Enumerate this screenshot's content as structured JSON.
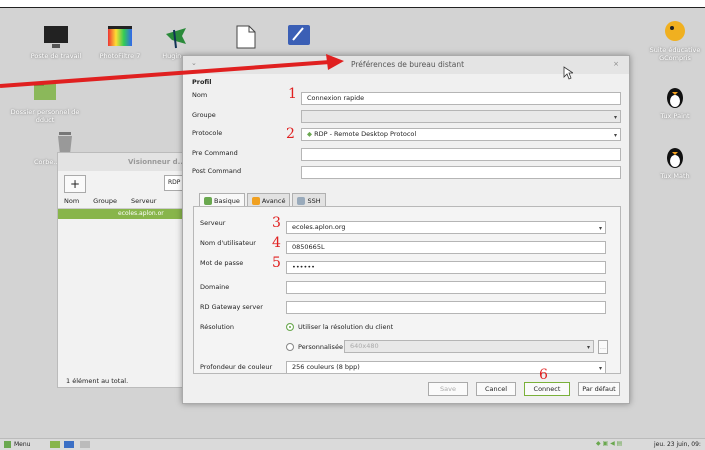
{
  "desktop": {
    "left_icons": [
      {
        "label": "Poste de travail"
      },
      {
        "label": "PhotoFiltre 7"
      },
      {
        "label": "Hugin-..."
      },
      {
        "label": "Dossier personnel de dduct"
      },
      {
        "label": "Corbe..."
      }
    ],
    "right_icons": [
      {
        "label": "Suite éducative GCompris"
      },
      {
        "label": "Tux Paint"
      },
      {
        "label": "Tux Math"
      }
    ]
  },
  "bg_window": {
    "title": "Visionneur d...",
    "add_label": "+",
    "proto_select": "RDP",
    "columns": [
      "Nom",
      "Groupe",
      "Serveur"
    ],
    "row_server": "ecoles.aplon.or",
    "footer": "1 élément au total."
  },
  "dialog": {
    "title": "Préférences de bureau distant",
    "close": "×",
    "minimize": "⌄",
    "profile_heading": "Profil",
    "name_label": "Nom",
    "name_value": "Connexion rapide",
    "group_label": "Groupe",
    "group_value": "",
    "protocol_label": "Protocole",
    "protocol_value": "RDP - Remote Desktop Protocol",
    "precmd_label": "Pre Command",
    "postcmd_label": "Post Command",
    "tabs": [
      {
        "label": "Basique"
      },
      {
        "label": "Avancé"
      },
      {
        "label": "SSH"
      }
    ],
    "server_label": "Serveur",
    "server_value": "ecoles.aplon.org",
    "user_label": "Nom d'utilisateur",
    "user_value": "0850665L",
    "pass_label": "Mot de passe",
    "pass_value": "••••••",
    "domain_label": "Domaine",
    "gateway_label": "RD Gateway server",
    "resolution_label": "Résolution",
    "res_client": "Utiliser la résolution du client",
    "res_custom": "Personnalisée",
    "res_custom_value": "640x480",
    "res_more": "...",
    "depth_label": "Profondeur de couleur",
    "depth_value": "256 couleurs (8 bpp)",
    "buttons": {
      "save": "Save",
      "cancel": "Cancel",
      "connect": "Connect",
      "default": "Par défaut"
    }
  },
  "annotations": [
    "1",
    "2",
    "3",
    "4",
    "5",
    "6"
  ],
  "taskbar": {
    "menu": "Menu",
    "clock": "jeu. 23 juin, 09:"
  },
  "colors": {
    "annotation_red": "#e02020",
    "accent_green": "#88b54b"
  }
}
